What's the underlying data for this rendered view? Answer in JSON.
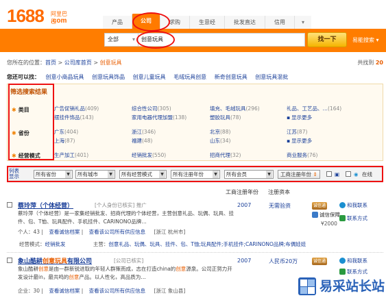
{
  "logo": {
    "mark": "1688",
    "cn": "阿里巴巴",
    "com": ".com"
  },
  "nav_tabs": [
    "产品",
    "公司",
    "求购",
    "生意经",
    "批发直达",
    "信用",
    "▾"
  ],
  "search": {
    "category": "全部",
    "query": "创意玩具",
    "button": "找一下",
    "easy_search": "易能搜索 ▾"
  },
  "breadcrumb": {
    "prefix": "您所在的位置：",
    "home": "首页",
    "sep": ">",
    "lib": "公司库首页",
    "current": "创意玩具"
  },
  "total": {
    "prefix": "共找到",
    "count": "20"
  },
  "also_search": {
    "label": "您还可以找：",
    "keywords": [
      "创意小商品玩具",
      "创意玩具饰品",
      "创意儿童玩具",
      "毛绒玩具创意",
      "新奇创意玩具",
      "创意玩具混批"
    ]
  },
  "filter": {
    "title": "筛选搜索结果",
    "category_label": "类目",
    "category_items": [
      {
        "name": "广告促销礼品",
        "count": "(409)"
      },
      {
        "name": "综合性公司",
        "count": "(305)"
      },
      {
        "name": "填充、毛绒玩具",
        "count": "(296)"
      },
      {
        "name": "礼品、工艺品、…",
        "count": "(164)"
      },
      {
        "name": "摆挂件饰品",
        "count": "(143)"
      },
      {
        "name": "家用电器代理加盟",
        "count": "(138)"
      },
      {
        "name": "塑胶玩具",
        "count": "(78)"
      }
    ],
    "province_label": "省份",
    "province_items": [
      {
        "name": "广东",
        "count": "(404)"
      },
      {
        "name": "浙江",
        "count": "(346)"
      },
      {
        "name": "北京",
        "count": "(88)"
      },
      {
        "name": "江苏",
        "count": "(87)"
      },
      {
        "name": "上海",
        "count": "(87)"
      },
      {
        "name": "福建",
        "count": "(48)"
      },
      {
        "name": "山东",
        "count": "(34)"
      }
    ],
    "more": "显示更多",
    "mode_label": "经营模式",
    "mode_items": [
      {
        "name": "生产加工",
        "count": "(401)"
      },
      {
        "name": "经销批发",
        "count": "(550)"
      },
      {
        "name": "招商代理",
        "count": "(32)"
      },
      {
        "name": "商业服务",
        "count": "(76)"
      }
    ]
  },
  "sortbar": {
    "list_mode": "列表\n显示",
    "selects": [
      "所有省份",
      "所有城市",
      "所有经营模式",
      "所有注册年份",
      "所有会员"
    ],
    "reg_year_btn": "工商注册年份",
    "online": "在线"
  },
  "col_heads": {
    "reg_year": "工商注册年份",
    "reg_capital": "注册资本"
  },
  "results": [
    {
      "name": "蔡玲萍（个体经营）",
      "tag": "[个人身份已核实]  推广",
      "desc_a": "蔡玲萍（个体经营）是一家集经销批发、招商代理的个体经营，主营创意礼品、玩偶、玩具、挂件、包、T恤、玩具配件、手机挂件、CARINONO品牌…",
      "meta_a": "个人：43",
      "meta_b": "查看诚信档案",
      "meta_c": "查看该公司所有供应信息",
      "loc": "[浙江 杭州市]",
      "year": "2007",
      "capital": "无需验资",
      "badge": "诚信通",
      "side_a": "和我联系",
      "side_b": "诚信保障",
      "side_c": "¥2000",
      "mode_label": "经营模式：",
      "mode": "经销批发",
      "main_label": "主营：",
      "main": "创意礼品、玩偶、玩具、挂件、包、T恤;玩具配件;手机挂件;CARINONO品牌;布偶娃娃"
    },
    {
      "name_pre": "象山酷耕",
      "name_hl": "创意玩具",
      "name_post": "有限公司",
      "tag": "[公司已核实]",
      "desc_a": "象山酷耕",
      "desc_hl": "创意",
      "desc_b": "是由一群新锐进取的年轻人群策而成，志在打造china的",
      "desc_hl2": "创意",
      "desc_c": "源泉。公司正努力开发设计最in，最共鸣的",
      "desc_hl3": "创意",
      "desc_d": "产品。以人性化，高品质为…",
      "meta_a": "企业：30",
      "meta_b": "查看诚信档案",
      "meta_c": "查看该公司所有供应信息",
      "loc": "[浙江 象山县]",
      "year": "2007",
      "capital": "人民币20万",
      "badge": "诚信通",
      "side_a": "和我联系",
      "side_c": "联系方式"
    }
  ],
  "watermark": {
    "text": "易采站长站"
  },
  "colors": {
    "brand": "#ff7d00",
    "link": "#1a3f99",
    "highlight": "#e85d00",
    "annotation": "#e11111"
  }
}
